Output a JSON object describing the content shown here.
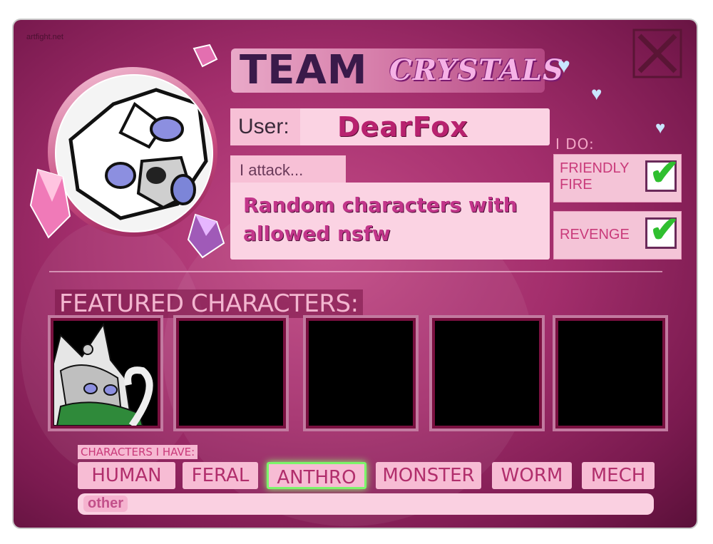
{
  "watermark": "artfight.net",
  "team": {
    "word": "TEAM",
    "name": "CRYSTALS"
  },
  "user": {
    "label": "User:",
    "name": "DearFox"
  },
  "attack": {
    "label": "I attack...",
    "text": "Random characters with allowed nsfw"
  },
  "i_do": {
    "label": "I DO:",
    "options": [
      {
        "label_line1": "FRIENDLY",
        "label_line2": "FIRE",
        "checked": true
      },
      {
        "label": "REVENGE",
        "checked": true
      }
    ]
  },
  "featured": {
    "label": "FEATURED CHARACTERS:",
    "slot_count": 5,
    "filled_slots": 1
  },
  "characters_have": {
    "label": "CHARACTERS I HAVE:",
    "tags": [
      {
        "label": "HUMAN",
        "active": false
      },
      {
        "label": "FERAL",
        "active": false
      },
      {
        "label": "ANTHRO",
        "active": true
      },
      {
        "label": "MONSTER",
        "active": false
      },
      {
        "label": "WORM",
        "active": false
      },
      {
        "label": "MECH",
        "active": false
      }
    ],
    "other_label": "other",
    "other_value": ""
  },
  "colors": {
    "card_bg": "#a32e6c",
    "pink_panel": "#fbd3e3",
    "accent_text": "#c2358a",
    "check_green": "#2fbf2f",
    "active_tag_glow": "#7cf56a"
  }
}
